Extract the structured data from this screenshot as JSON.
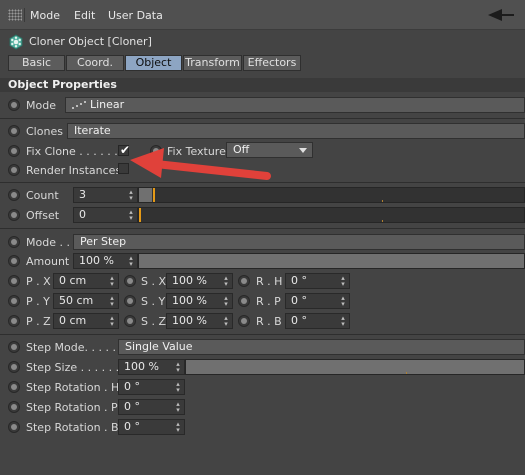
{
  "menubar": {
    "items": [
      "Mode",
      "Edit",
      "User Data"
    ]
  },
  "object": {
    "title": "Cloner Object [Cloner]"
  },
  "tabs": [
    "Basic",
    "Coord.",
    "Object",
    "Transform",
    "Effectors"
  ],
  "active_tab": "Object",
  "section": {
    "title": "Object Properties"
  },
  "mode": {
    "label": "Mode",
    "value": "Linear"
  },
  "clones": {
    "label": "Clones",
    "value": "Iterate"
  },
  "fix_clone": {
    "label": "Fix Clone . . . . . . .",
    "checked": true
  },
  "fix_texture": {
    "label": "Fix Texture",
    "value": "Off"
  },
  "render_instances": {
    "label": "Render Instances",
    "checked": false
  },
  "count": {
    "label": "Count",
    "value": "3"
  },
  "offset": {
    "label": "Offset",
    "value": "0"
  },
  "step_mode_block": {
    "mode_label": "Mode . .",
    "mode_value": "Per Step",
    "amount_label": "Amount",
    "amount_value": "100 %"
  },
  "transform": {
    "pos": [
      {
        "label": "P . X",
        "value": "0 cm"
      },
      {
        "label": "P . Y",
        "value": "50 cm"
      },
      {
        "label": "P . Z",
        "value": "0 cm"
      }
    ],
    "scale": [
      {
        "label": "S . X",
        "value": "100 %"
      },
      {
        "label": "S . Y",
        "value": "100 %"
      },
      {
        "label": "S . Z",
        "value": "100 %"
      }
    ],
    "rot": [
      {
        "label": "R . H",
        "value": "0 °"
      },
      {
        "label": "R . P",
        "value": "0 °"
      },
      {
        "label": "R . B",
        "value": "0 °"
      }
    ]
  },
  "step": {
    "mode_label": "Step Mode. . . . . .",
    "mode_value": "Single Value",
    "size_label": "Step Size . . . . . .",
    "size_value": "100 %",
    "rot_h_label": "Step Rotation . H",
    "rot_h_value": "0 °",
    "rot_p_label": "Step Rotation . P",
    "rot_p_value": "0 °",
    "rot_b_label": "Step Rotation . B",
    "rot_b_value": "0 °"
  },
  "colors": {
    "annotation_arrow": "#e0413a",
    "active_tab": "#8da5c3",
    "slider_handle": "#e59a17"
  },
  "icons": [
    "grip-icon",
    "nav-back-icon",
    "nav-forward-icon",
    "cloner-icon",
    "dropdown-arrow-icon",
    "spinner-icon",
    "annotation-arrow"
  ]
}
